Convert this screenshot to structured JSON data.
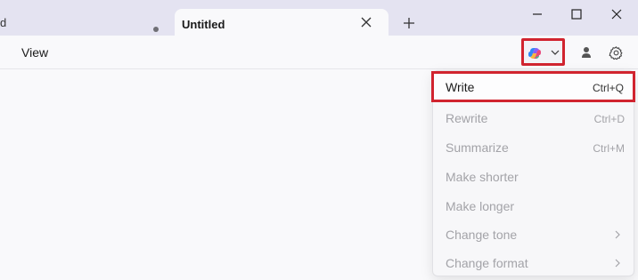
{
  "tabs": {
    "inactive_label": "d",
    "active_label": "Untitled"
  },
  "toolbar": {
    "view_label": "View"
  },
  "dropdown": {
    "items": [
      {
        "label": "Write",
        "shortcut": "Ctrl+Q",
        "enabled": true,
        "highlighted": true
      },
      {
        "label": "Rewrite",
        "shortcut": "Ctrl+D",
        "enabled": false
      },
      {
        "label": "Summarize",
        "shortcut": "Ctrl+M",
        "enabled": false
      },
      {
        "label": "Make shorter",
        "shortcut": "",
        "enabled": false
      },
      {
        "label": "Make longer",
        "shortcut": "",
        "enabled": false
      },
      {
        "label": "Change tone",
        "shortcut": "",
        "enabled": false,
        "submenu": true
      },
      {
        "label": "Change format",
        "shortcut": "",
        "enabled": false,
        "submenu": true
      }
    ]
  },
  "colors": {
    "highlight_border": "#d1242f",
    "titlebar_bg": "#e4e3f1",
    "disabled_text": "#a3a3a8"
  },
  "icons": [
    "close-icon",
    "new-tab-icon",
    "minimize-icon",
    "maximize-icon",
    "window-close-icon",
    "copilot-icon",
    "chevron-down-icon",
    "profile-icon",
    "gear-icon",
    "chevron-right-icon"
  ]
}
